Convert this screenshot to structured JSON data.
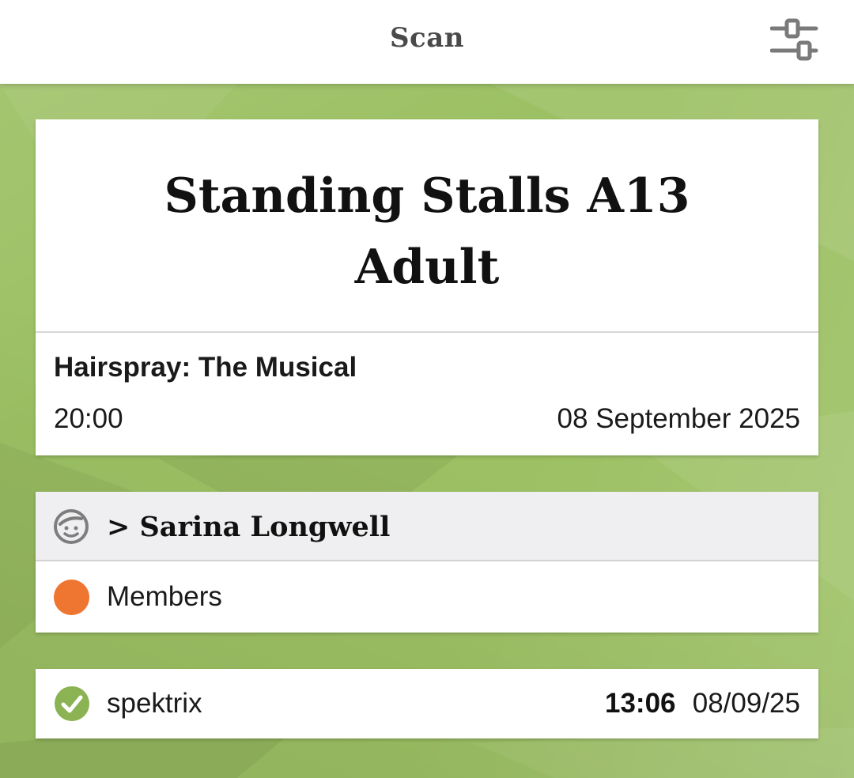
{
  "header": {
    "title": "Scan",
    "settings_icon": "sliders-icon"
  },
  "ticket": {
    "line1": "Standing Stalls A13",
    "line2": "Adult",
    "event_name": "Hairspray: The Musical",
    "time": "20:00",
    "date": "08 September 2025"
  },
  "customer": {
    "icon": "user-face-icon",
    "name": "> Sarina Longwell",
    "membership": "Members",
    "membership_color": "#ee7631"
  },
  "scan": {
    "status_icon": "check-circle-icon",
    "status_color": "#8bb353",
    "source": "spektrix",
    "time": "13:06",
    "date": "08/09/25"
  },
  "colors": {
    "background": "#9cc063",
    "header_bg": "#ffffff",
    "customer_header_bg": "#efeff1"
  }
}
